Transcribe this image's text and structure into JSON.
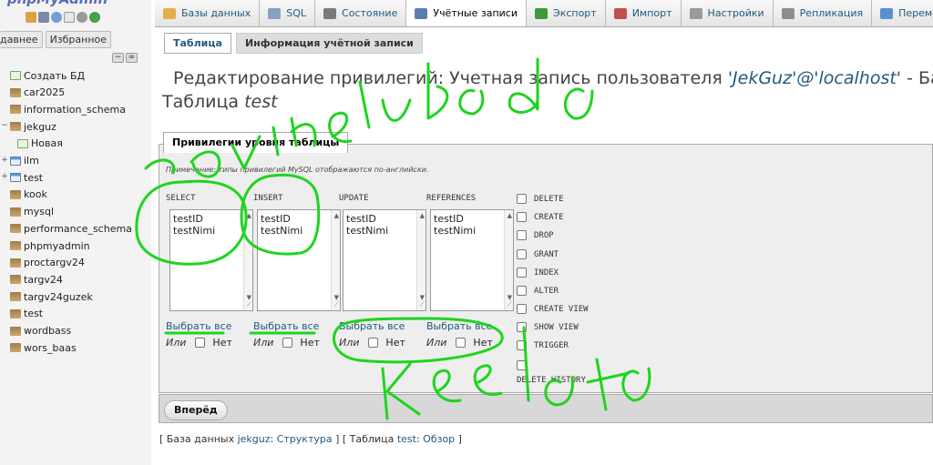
{
  "sidebar": {
    "logo_text": "phpMyAdmin",
    "tabs": [
      "давнее",
      "Избранное"
    ],
    "controls": [
      "−",
      "∞"
    ],
    "tree": [
      {
        "label": "Создать БД",
        "type": "new",
        "expander": ""
      },
      {
        "label": "car2025",
        "type": "db",
        "expander": ""
      },
      {
        "label": "information_schema",
        "type": "db",
        "expander": ""
      },
      {
        "label": "jekguz",
        "type": "db",
        "expander": "−"
      },
      {
        "label": "Новая",
        "type": "new",
        "expander": ""
      },
      {
        "label": "ilm",
        "type": "table",
        "expander": "+"
      },
      {
        "label": "test",
        "type": "table",
        "expander": "+"
      },
      {
        "label": "kook",
        "type": "db",
        "expander": ""
      },
      {
        "label": "mysql",
        "type": "db",
        "expander": ""
      },
      {
        "label": "performance_schema",
        "type": "db",
        "expander": ""
      },
      {
        "label": "phpmyadmin",
        "type": "db",
        "expander": ""
      },
      {
        "label": "proctargv24",
        "type": "db",
        "expander": ""
      },
      {
        "label": "targv24",
        "type": "db",
        "expander": ""
      },
      {
        "label": "targv24guzek",
        "type": "db",
        "expander": ""
      },
      {
        "label": "test",
        "type": "db",
        "expander": ""
      },
      {
        "label": "wordbass",
        "type": "db",
        "expander": ""
      },
      {
        "label": "wors_baas",
        "type": "db",
        "expander": ""
      }
    ]
  },
  "topbar": {
    "tabs": [
      {
        "label": "Базы данных",
        "icon": "databases-icon",
        "active": false
      },
      {
        "label": "SQL",
        "icon": "sql-icon",
        "active": false
      },
      {
        "label": "Состояние",
        "icon": "status-icon",
        "active": false
      },
      {
        "label": "Учётные записи",
        "icon": "user-accounts-icon",
        "active": true
      },
      {
        "label": "Экспорт",
        "icon": "export-icon",
        "active": false
      },
      {
        "label": "Импорт",
        "icon": "import-icon",
        "active": false
      },
      {
        "label": "Настройки",
        "icon": "wrench-icon",
        "active": false
      },
      {
        "label": "Репликация",
        "icon": "replication-icon",
        "active": false
      },
      {
        "label": "Переменные",
        "icon": "variables-icon",
        "active": false
      }
    ]
  },
  "subtabs": {
    "table": "Таблица",
    "account_info": "Информация учётной записи"
  },
  "heading": {
    "prefix": "Редактирование привилегий: Учетная запись пользователя ",
    "user": "'JekGuz'@'localhost'",
    "suffix": " - Ба",
    "table_word": "Таблица ",
    "table_name": "test"
  },
  "privileges": {
    "legend": "Привилегии уровня таблицы",
    "note": "Примечание: типы привилегий MySQL отображаются по-английски.",
    "columns": [
      {
        "header": "SELECT",
        "options": [
          "testID",
          "testNimi"
        ]
      },
      {
        "header": "INSERT",
        "options": [
          "testID",
          "testNimi"
        ]
      },
      {
        "header": "UPDATE",
        "options": [
          "testID",
          "testNimi"
        ]
      },
      {
        "header": "REFERENCES",
        "options": [
          "testID",
          "testNimi"
        ]
      }
    ],
    "select_all": "Выбрать все",
    "or_label": "Или",
    "none_label": "Нет",
    "checkboxes": [
      "DELETE",
      "CREATE",
      "DROP",
      "GRANT",
      "INDEX",
      "ALTER",
      "CREATE VIEW",
      "SHOW VIEW",
      "TRIGGER",
      "DELETE HISTORY"
    ]
  },
  "footer": {
    "go_button": "Вперёд",
    "crumbs": {
      "open": "[ ",
      "db_label": "База данных ",
      "db_name": "jekguz",
      "sep1": ": ",
      "structure": "Структура",
      "mid": " ] [ ",
      "table_label": "Таблица ",
      "table_name": "test",
      "sep2": ": ",
      "browse": "Обзор",
      "close": " ]"
    }
  },
  "colors": {
    "link": "#235a81",
    "scribble": "#1fd41f"
  }
}
